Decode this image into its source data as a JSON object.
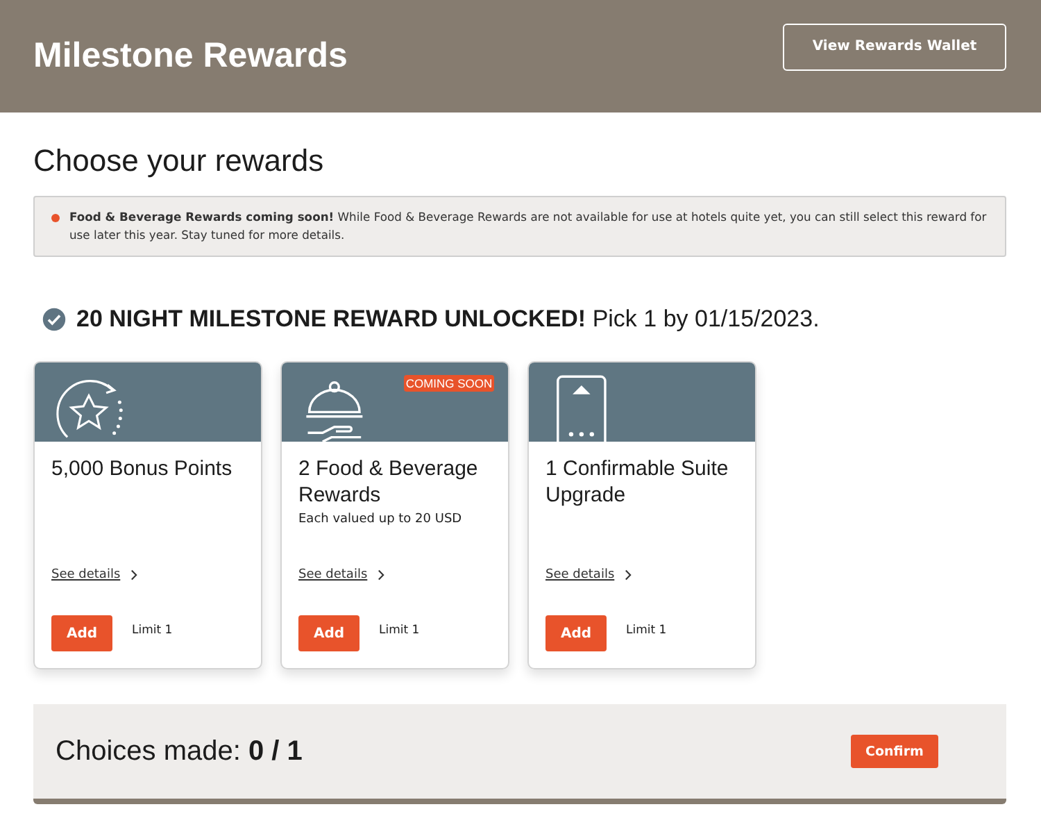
{
  "header": {
    "title": "Milestone Rewards",
    "wallet_button": "View Rewards Wallet"
  },
  "heading": "Choose your rewards",
  "notice": {
    "text": "**Food & Beverage Rewards coming soon!** While Food & Beverage Rewards are not available for use at hotels quite yet, you can still select this reward for use later this year. Stay tuned for more details."
  },
  "unlocked": "**20 NIGHT MILESTONE REWARD UNLOCKED!** Pick 1 by 01/15/2023.",
  "rewards": [
    {
      "kind": "points",
      "title": "5,000 Bonus Points",
      "details_link": "See details",
      "add_button": "Add",
      "limit": "Limit 1"
    },
    {
      "kind": "food",
      "badge": "COMING SOON",
      "title": "2 Food & Beverage Rewards",
      "subtitle": "Each valued up to 20 USD",
      "details_link": "See details",
      "add_button": "Add",
      "limit": "Limit 1"
    },
    {
      "kind": "suite",
      "title": "1 Confirmable Suite Upgrade",
      "details_link": "See details",
      "add_button": "Add",
      "limit": "Limit 1"
    }
  ],
  "footer": {
    "choices": "Choices made: **0 / 1**",
    "confirm_button": "Confirm"
  }
}
